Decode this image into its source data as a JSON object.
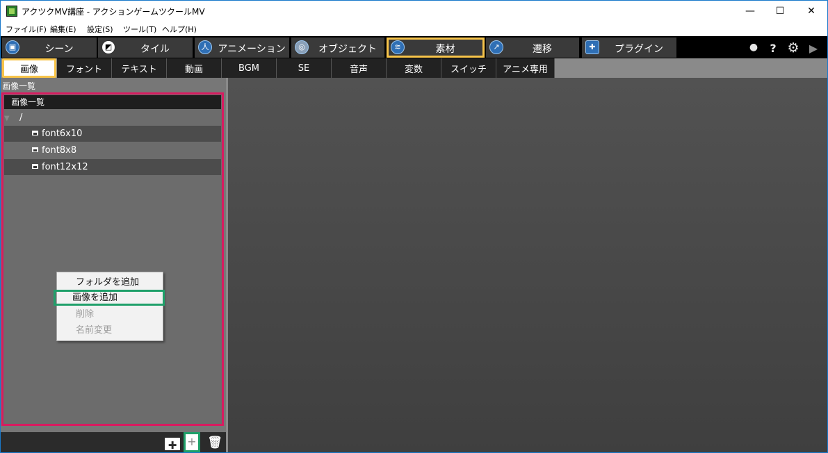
{
  "window": {
    "title": "アクツクMV講座 - アクションゲームツクールMV",
    "controls": {
      "minimize": "—",
      "maximize": "☐",
      "close": "✕"
    }
  },
  "menu": [
    "ファイル(F)",
    "編集(E)",
    "設定(S)",
    "ツール(T)",
    "ヘルプ(H)"
  ],
  "main_tabs": [
    {
      "label": "シーン",
      "icon": "scene-icon",
      "selected": false
    },
    {
      "label": "タイル",
      "icon": "tile-icon",
      "selected": false
    },
    {
      "label": "アニメーション",
      "icon": "animation-icon",
      "selected": false
    },
    {
      "label": "オブジェクト",
      "icon": "object-icon",
      "selected": false
    },
    {
      "label": "素材",
      "icon": "resource-icon",
      "selected": true
    },
    {
      "label": "遷移",
      "icon": "transition-icon",
      "selected": false
    },
    {
      "label": "プラグイン",
      "icon": "plugin-icon",
      "selected": false
    }
  ],
  "right_icons": [
    "undo-icon",
    "help-icon",
    "settings-icon",
    "play-icon"
  ],
  "sub_tabs": [
    {
      "label": "画像",
      "selected": true
    },
    {
      "label": "フォント",
      "selected": false
    },
    {
      "label": "テキスト",
      "selected": false
    },
    {
      "label": "動画",
      "selected": false
    },
    {
      "label": "BGM",
      "selected": false
    },
    {
      "label": "SE",
      "selected": false
    },
    {
      "label": "音声",
      "selected": false
    },
    {
      "label": "変数",
      "selected": false
    },
    {
      "label": "スイッチ",
      "selected": false
    },
    {
      "label": "アニメ専用",
      "selected": false
    }
  ],
  "left_panel": {
    "caption": "画像一覧",
    "tree_header": "画像一覧",
    "root": "/",
    "items": [
      "font6x10",
      "font8x8",
      "font12x12"
    ]
  },
  "context_menu": [
    {
      "label": "フォルダを追加",
      "enabled": true,
      "highlighted": false
    },
    {
      "label": "画像を追加",
      "enabled": true,
      "highlighted": true
    },
    {
      "label": "削除",
      "enabled": false,
      "highlighted": false
    },
    {
      "label": "名前変更",
      "enabled": false,
      "highlighted": false
    }
  ],
  "bottom_toolbar": [
    "add-folder-icon",
    "add-image-icon",
    "delete-icon"
  ],
  "colors": {
    "selection_outline": "#f7c44a",
    "tree_outline": "#d81b60",
    "highlight_outline": "#1fa06a",
    "window_border": "#1979ca"
  }
}
